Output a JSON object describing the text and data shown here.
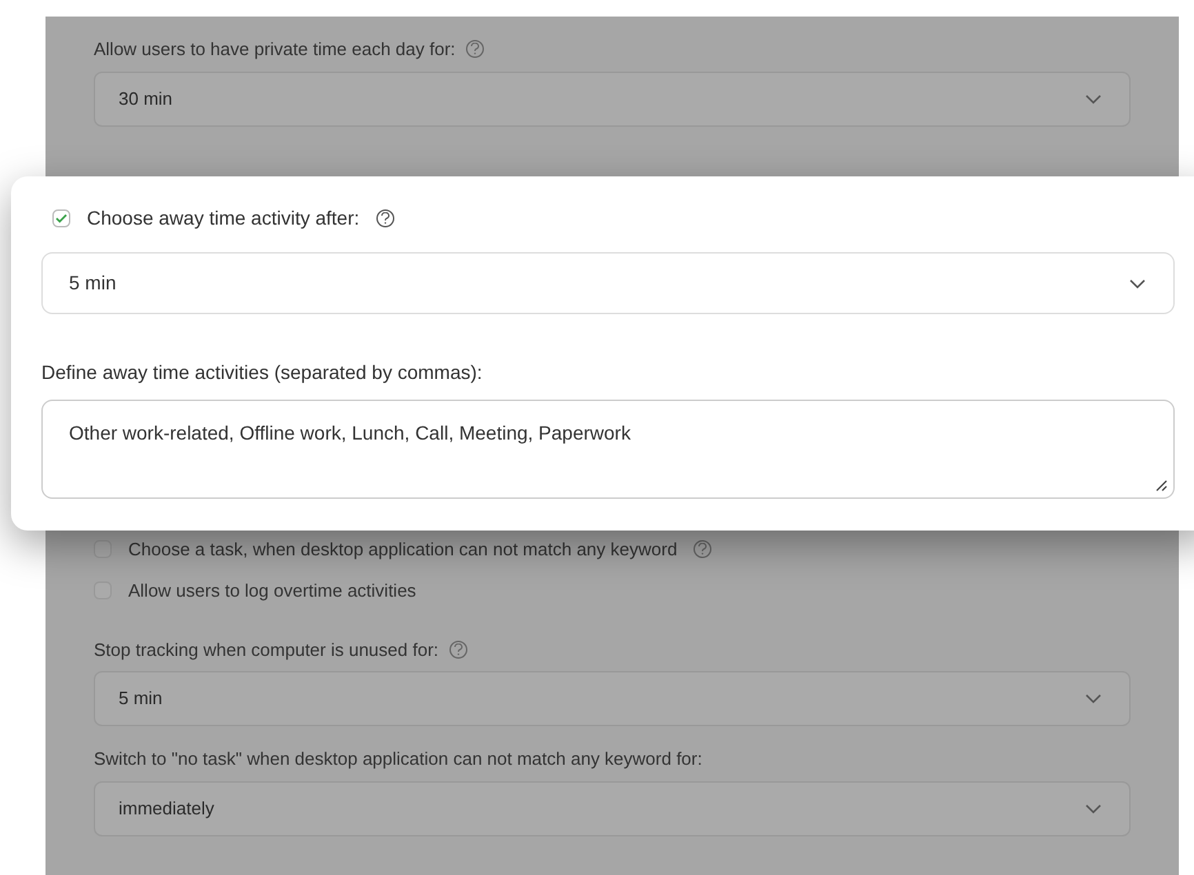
{
  "background_form": {
    "fields": [
      {
        "kind": "select",
        "label": "Allow users to have private time each day for:",
        "help": true,
        "value": "30 min"
      },
      {
        "kind": "checkbox",
        "label": "Choose a task, when desktop application can not match any keyword",
        "checked": false,
        "help": true
      },
      {
        "kind": "checkbox",
        "label": "Allow users to log overtime activities",
        "checked": false,
        "help": false
      },
      {
        "kind": "select",
        "label": "Stop tracking when computer is unused for:",
        "help": true,
        "value": "5 min"
      },
      {
        "kind": "select",
        "label": "Switch to \"no task\" when desktop application can not match any keyword for:",
        "help": false,
        "value": "immediately"
      }
    ]
  },
  "dialog": {
    "checkbox": {
      "label": "Choose away time activity after:",
      "checked": true,
      "help": true
    },
    "select": {
      "value": "5 min"
    },
    "activities": {
      "label": "Define away time activities (separated by commas):",
      "value": "Other work-related, Offline work, Lunch, Call, Meeting, Paperwork"
    }
  }
}
